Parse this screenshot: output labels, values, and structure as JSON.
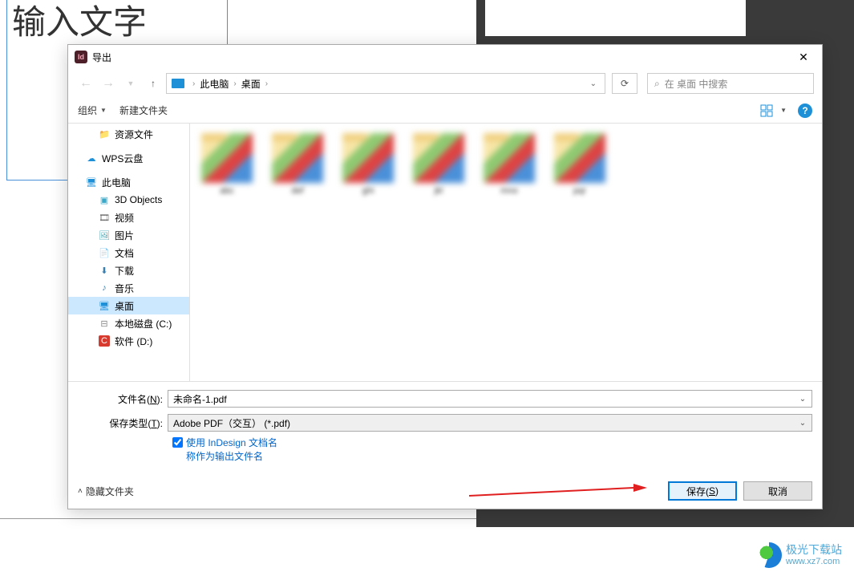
{
  "background": {
    "placeholder_text": "输入文字"
  },
  "dialog": {
    "title": "导出",
    "breadcrumb": {
      "pc": "此电脑",
      "desktop": "桌面"
    },
    "search_placeholder": "在 桌面 中搜索",
    "toolbar": {
      "organize": "组织",
      "new_folder": "新建文件夹"
    },
    "sidebar": {
      "resources": "资源文件",
      "wps": "WPS云盘",
      "this_pc": "此电脑",
      "objects3d": "3D Objects",
      "video": "视频",
      "pictures": "图片",
      "documents": "文档",
      "downloads": "下载",
      "music": "音乐",
      "desktop": "桌面",
      "local_c": "本地磁盘 (C:)",
      "soft_d": "软件 (D:)"
    },
    "filename_label_prefix": "文件名(",
    "filename_label_key": "N",
    "filename_label_suffix": "):",
    "filename_value": "未命名-1.pdf",
    "filetype_label_prefix": "保存类型(",
    "filetype_label_key": "T",
    "filetype_label_suffix": "):",
    "filetype_value": "Adobe PDF（交互）   (*.pdf)",
    "checkbox_line1": "使用 InDesign 文档名",
    "checkbox_line2": "称作为输出文件名",
    "hide_folders": "隐藏文件夹",
    "save_button_prefix": "保存(",
    "save_button_key": "S",
    "save_button_suffix": ")",
    "cancel_button": "取消"
  },
  "watermark": {
    "title": "极光下载站",
    "url": "www.xz7.com"
  }
}
